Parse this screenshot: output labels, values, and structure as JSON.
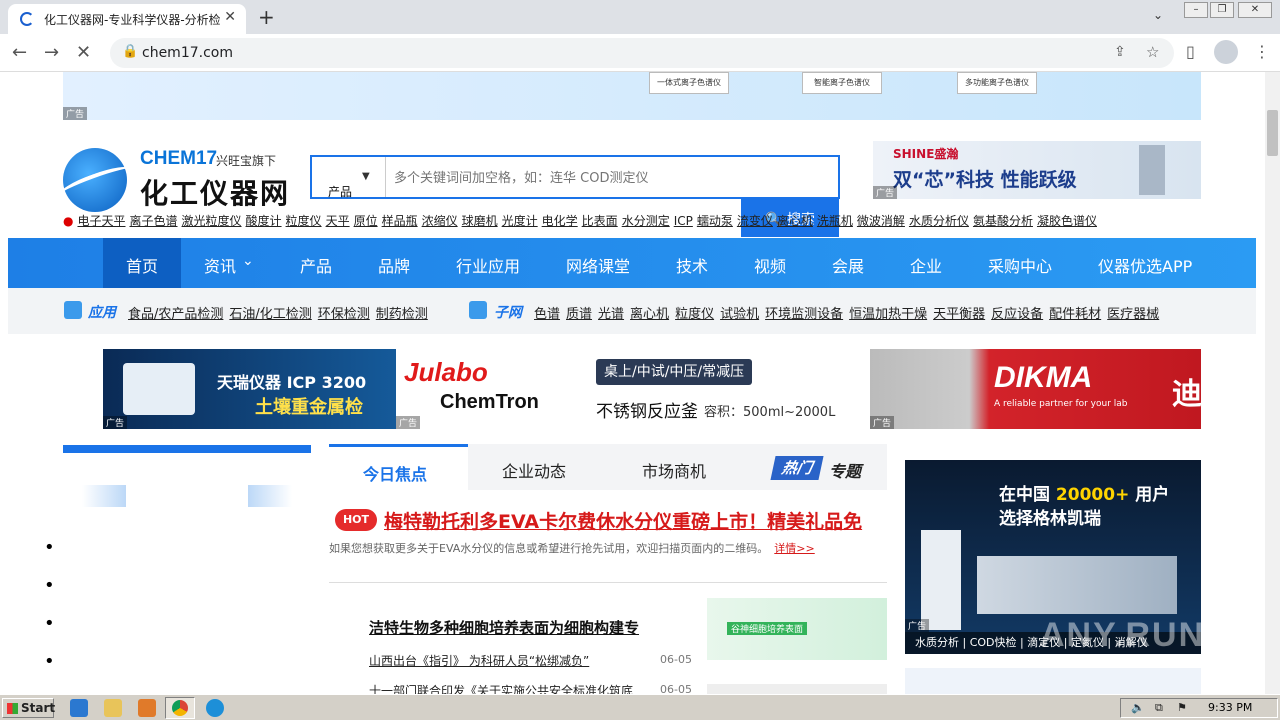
{
  "browser": {
    "tab_title": "化工仪器网-专业科学仪器-分析检测",
    "url": "chem17.com",
    "new_tab_label": "+",
    "close_tab_label": "✕"
  },
  "top_ad": {
    "products": [
      "一体式离子色谱仪",
      "智能离子色谱仪",
      "多功能离子色谱仪"
    ],
    "ad_label": "广告"
  },
  "logo": {
    "en": "CHEM",
    "en_num": "17",
    "sub": "兴旺宝旗下",
    "cn": "化工仪器网"
  },
  "search": {
    "category": "产品",
    "placeholder": "多个关键词间加空格，如：连华 COD测定仪",
    "button": "搜索"
  },
  "right_ad": {
    "brand": "SHINE盛瀚",
    "slogan": "双“芯”科技 性能跃级",
    "ad_label": "广告"
  },
  "hot_links": [
    "电子天平",
    "离子色谱",
    "激光粒度仪",
    "酸度计",
    "粒度仪",
    "天平",
    "原位",
    "样品瓶",
    "浓缩仪",
    "球磨机",
    "光度计",
    "电化学",
    "比表面",
    "水分测定",
    "ICP",
    "蠕动泵",
    "流变仪",
    "离心机",
    "洗瓶机",
    "微波消解",
    "水质分析仪",
    "氨基酸分析",
    "凝胶色谱仪"
  ],
  "nav": [
    "首页",
    "资讯",
    "产品",
    "品牌",
    "行业应用",
    "网络课堂",
    "技术",
    "视频",
    "会展",
    "企业",
    "采购中心",
    "仪器优选APP"
  ],
  "subnav": {
    "app_title": "应用",
    "app_links": [
      "食品/农产品检测",
      "石油/化工检测",
      "环保检测",
      "制药检测"
    ],
    "sub_title": "子网",
    "sub_links": [
      "色谱",
      "质谱",
      "光谱",
      "离心机",
      "粒度仪",
      "试验机",
      "环境监测设备",
      "恒温加热干燥",
      "天平衡器",
      "反应设备",
      "配件耗材",
      "医疗器械"
    ]
  },
  "banners": {
    "b1_line1": "天瑞仪器 ICP 3200",
    "b1_line2": "土壤重金属检",
    "b2_brand1": "Julabo",
    "b2_brand2": "ChemTron",
    "b2_pill": "桌上/中试/中压/常减压",
    "b2_name": "不锈钢反应釜",
    "b2_vol": "容积：500ml~2000L",
    "b3_brand": "DIKMA",
    "b3_slogan": "A reliable partner for your lab",
    "b3_cn": "迪",
    "ad_label": "广告"
  },
  "news_tabs": [
    "今日焦点",
    "企业动态",
    "市场商机",
    "热门",
    "专题"
  ],
  "focus": {
    "hot_badge": "HOT",
    "headline": "梅特勒托利多EVA卡尔费休水分仪重磅上市！精美礼品免",
    "summary": "如果您想获取更多关于EVA水分仪的信息或希望进行抢先试用，欢迎扫描页面内的二维码。",
    "more": "详情>>"
  },
  "articles": [
    {
      "title": "洁特生物多种细胞培养表面为细胞构建专",
      "date": ""
    },
    {
      "title": "山西出台《指引》 为科研人员“松绑减负”",
      "date": "06-05"
    },
    {
      "title": "十一部门联合印发《关于实施公共安全标准化筑底",
      "date": "06-05"
    }
  ],
  "article_img": {
    "tag": "谷神细胞培养表面"
  },
  "right_side_ad": {
    "line1_pre": "在中国",
    "line1_num": "20000+",
    "line1_post": "用户",
    "line2": "选择格林凯瑞",
    "footer": "水质分析 | COD快检 | 滴定仪 | 定氮仪 | 消解仪",
    "ad_label": "广告"
  },
  "watermark": "ANY.RUN",
  "taskbar": {
    "start": "Start",
    "clock": "9:33 PM"
  },
  "colors": {
    "brand_blue": "#1a73e8",
    "hot_red": "#d61a1a"
  }
}
